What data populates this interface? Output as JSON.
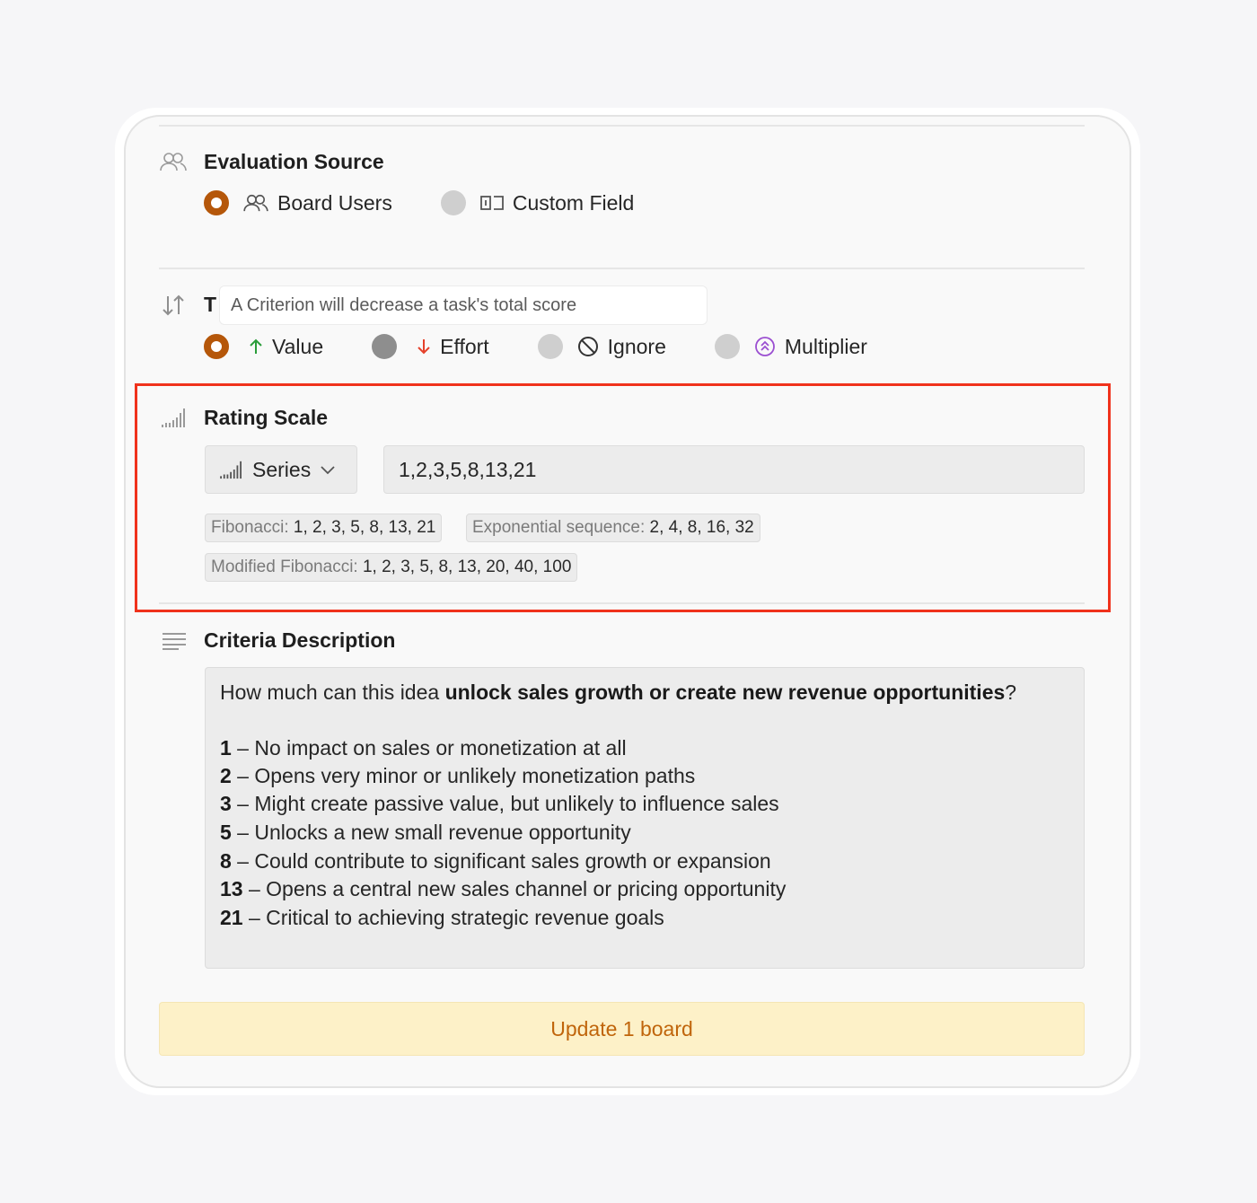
{
  "evaluation_source": {
    "title": "Evaluation Source",
    "options": [
      {
        "label": "Board Users",
        "selected": true,
        "icon": "users-icon"
      },
      {
        "label": "Custom Field",
        "selected": false,
        "icon": "custom-field-icon"
      }
    ]
  },
  "type": {
    "title_peek": "T",
    "tooltip": "A Criterion will decrease a task's total score",
    "options": [
      {
        "label": "Value",
        "selected": true,
        "icon": "arrow-up-icon",
        "color": "#2a9d3a"
      },
      {
        "label": "Effort",
        "selected": false,
        "icon": "arrow-down-icon",
        "color": "#e5412b"
      },
      {
        "label": "Ignore",
        "selected": false,
        "icon": "ban-icon",
        "color": "#333333"
      },
      {
        "label": "Multiplier",
        "selected": false,
        "icon": "multiplier-icon",
        "color": "#9b4fd1"
      }
    ]
  },
  "rating_scale": {
    "title": "Rating Scale",
    "mode_label": "Series",
    "value": "1,2,3,5,8,13,21",
    "presets": [
      {
        "name": "Fibonacci:",
        "values": "1, 2, 3, 5, 8, 13, 21"
      },
      {
        "name": "Exponential sequence:",
        "values": "2, 4, 8, 16, 32"
      },
      {
        "name": "Modified Fibonacci:",
        "values": "1, 2, 3, 5, 8, 13, 20, 40, 100"
      }
    ]
  },
  "criteria_description": {
    "title": "Criteria Description",
    "intro_before": "How much can this idea ",
    "intro_bold": "unlock sales growth or create new revenue opportunities",
    "intro_after": "?",
    "levels": [
      {
        "score": "1",
        "text": " – No impact on sales or monetization at all"
      },
      {
        "score": "2",
        "text": " – Opens very minor or unlikely monetization paths"
      },
      {
        "score": "3",
        "text": " – Might create passive value, but unlikely to influence sales"
      },
      {
        "score": "5",
        "text": " – Unlocks a new small revenue opportunity"
      },
      {
        "score": "8",
        "text": " – Could contribute to significant sales growth or expansion"
      },
      {
        "score": "13",
        "text": " – Opens a central new sales channel or pricing opportunity"
      },
      {
        "score": "21",
        "text": " – Critical to achieving strategic revenue goals"
      }
    ]
  },
  "update_button": "Update 1 board",
  "colors": {
    "accent": "#b5570a",
    "highlight_border": "#f0321c",
    "update_bg": "#fdf1c8",
    "update_text": "#c0650b"
  }
}
